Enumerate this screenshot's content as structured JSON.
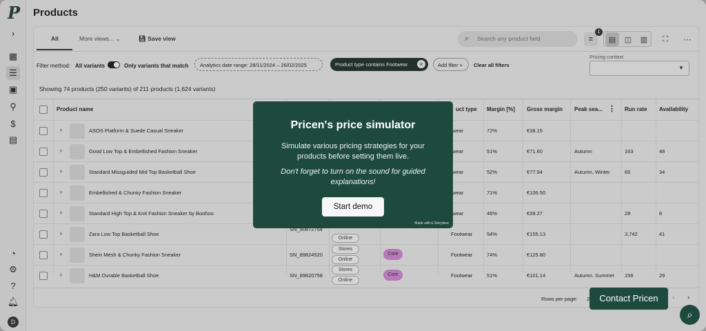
{
  "page": {
    "title": "Products"
  },
  "sidebar": {
    "logo": "P",
    "avatar": "D",
    "icons": [
      "chevron-right-icon",
      "dashboard-icon",
      "list-icon",
      "image-icon",
      "flow-icon",
      "price-icon",
      "store-icon",
      "settings-alert-icon",
      "gear-icon",
      "help-icon",
      "bell-icon"
    ]
  },
  "tabs": {
    "all": "All",
    "more_views": "More views...",
    "save_view": "Save view"
  },
  "toolbar": {
    "search_placeholder": "Search any product field",
    "filter_count": "1"
  },
  "filters": {
    "method_label": "Filter method:",
    "all_variants": "All variants",
    "only_matching": "Only variants that match",
    "date_chip": "Analytics date range:  28/11/2024  –  26/02/2025",
    "type_chip": "Product type contains Footwear",
    "add_filter": "Add filter +",
    "clear_all": "Clear all filters",
    "pricing_context_label": "Pricing context"
  },
  "summary": "Showing 74 products (250 variants) of 211 products (1,624 variants)",
  "table": {
    "headers": {
      "name": "Product name",
      "type": "uct type",
      "margin": "Margin [%]",
      "gross": "Gross margin",
      "peak": "Peak sea...",
      "run_rate": "Run rate",
      "availability": "Availability"
    },
    "rows": [
      {
        "name": "ASOS Platform & Suede Casual Sneaker",
        "sku": "",
        "type": "twear",
        "margin": "72%",
        "gross": "€38.15",
        "peak": "",
        "run_rate": "",
        "availability": ""
      },
      {
        "name": "Good Low Top & Embellished Fashion Sneaker",
        "sku": "",
        "type": "twear",
        "margin": "51%",
        "gross": "€71.60",
        "peak": "Autumn",
        "run_rate": "163",
        "availability": "48"
      },
      {
        "name": "Standard Missguided Mid Top Basketball Shoe",
        "sku": "",
        "type": "twear",
        "margin": "52%",
        "gross": "€77.94",
        "peak": "Autumn, Winter",
        "run_rate": "65",
        "availability": "34"
      },
      {
        "name": "Embellished & Chunky Fashion Sneaker",
        "sku": "",
        "type": "twear",
        "margin": "71%",
        "gross": "€106.50",
        "peak": "",
        "run_rate": "",
        "availability": ""
      },
      {
        "name": "Standard High Top & Knit Fashion Sneaker by Boohoo",
        "sku": "",
        "type": "twear",
        "margin": "46%",
        "gross": "€39.27",
        "peak": "",
        "run_rate": "28",
        "availability": "8"
      },
      {
        "name": "Zara Low Top Basketball Shoe",
        "sku": "SN_90872754",
        "type": "Footwear",
        "margin": "54%",
        "gross": "€155.13",
        "peak": "",
        "run_rate": "3,742",
        "availability": "41"
      },
      {
        "name": "Shein Mesh & Chunky Fashion Sneaker",
        "sku": "SN_89824520",
        "type": "Footwear",
        "margin": "74%",
        "gross": "€125.80",
        "peak": "",
        "run_rate": "",
        "availability": ""
      },
      {
        "name": "H&M Durable Basketball Shoe",
        "sku": "SN_89820758",
        "type": "Footwear",
        "margin": "51%",
        "gross": "€101.14",
        "peak": "Autumn, Summer",
        "run_rate": "156",
        "availability": "29"
      }
    ],
    "channel_stores": "Stores",
    "channel_online": "Online",
    "core": "Core"
  },
  "footer": {
    "rows_per_page": "Rows per page:",
    "rows_value": "2"
  },
  "modal": {
    "title": "Pricen's price simulator",
    "body": "Simulate various pricing strategies for your products before setting them live.",
    "note": "Don't forget to turn on the sound for guided explanations!",
    "button": "Start demo",
    "made_with": "Made with ⑆ Storylane"
  },
  "contact_button": "Contact Pricen",
  "colors": {
    "brand": "#1e4a3e",
    "overlay": "#c9c9c9"
  }
}
